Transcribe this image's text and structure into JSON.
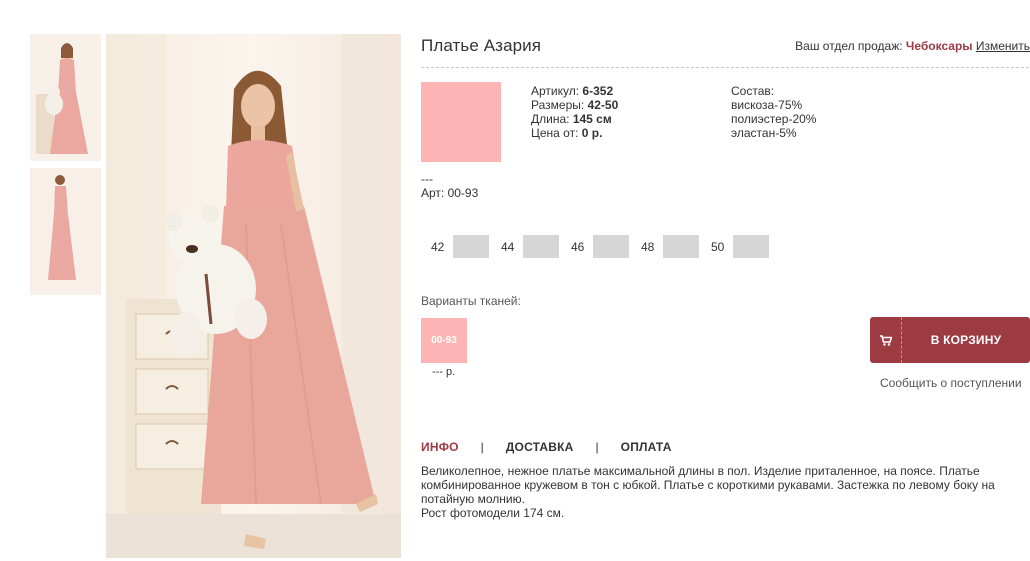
{
  "product": {
    "title": "Платье Азария",
    "color_hex": "#fdb4b4",
    "dashes": "---",
    "art": "Арт: 00-93"
  },
  "sales_department": {
    "label": "Ваш отдел продаж:",
    "city": "Чебоксары",
    "change_link": "Изменить"
  },
  "specs": {
    "article_label": "Артикул:",
    "article_value": "6-352",
    "sizes_label": "Размеры:",
    "sizes_value": "42-50",
    "length_label": "Длина:",
    "length_value": "145 см",
    "price_label": "Цена от:",
    "price_value": "0 р."
  },
  "composition": {
    "label": "Состав:",
    "items": [
      "вискоза-75%",
      "полиэстер-20%",
      "эластан-5%"
    ]
  },
  "sizes": [
    "42",
    "44",
    "46",
    "48",
    "50"
  ],
  "fabrics": {
    "label": "Варианты тканей:",
    "items": [
      {
        "code": "00-93",
        "price": "--- р.",
        "color": "#fdb4b4"
      }
    ]
  },
  "cart": {
    "button_label": "В КОРЗИНУ",
    "notify_label": "Сообщить о поступлении",
    "accent_color": "#9d3b43"
  },
  "tabs": [
    {
      "label": "ИНФО",
      "active": true
    },
    {
      "label": "ДОСТАВКА",
      "active": false
    },
    {
      "label": "ОПЛАТА",
      "active": false
    }
  ],
  "tab_separator": "|",
  "description": {
    "text": "Великолепное, нежное платье максимальной длины в пол. Изделие приталенное, на поясе. Платье комбинированное кружевом в тон с юбкой. Платье с короткими рукавами. Застежка по левому боку на потайную молнию.",
    "height": "Рост фотомодели 174 см."
  }
}
